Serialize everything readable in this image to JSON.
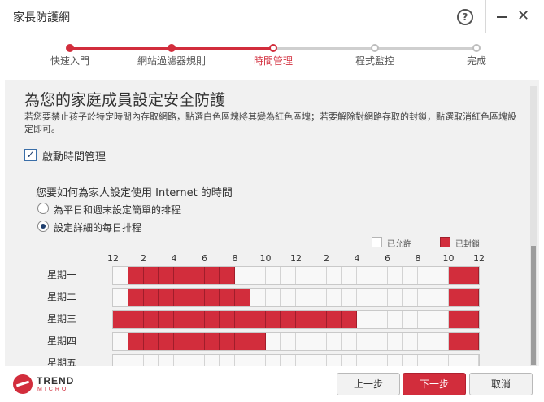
{
  "window": {
    "title": "家長防護網"
  },
  "wizard": {
    "steps": [
      {
        "label": "快速入門",
        "state": "done"
      },
      {
        "label": "網站過濾器規則",
        "state": "done"
      },
      {
        "label": "時間管理",
        "state": "current"
      },
      {
        "label": "程式監控",
        "state": "todo"
      },
      {
        "label": "完成",
        "state": "todo"
      }
    ]
  },
  "main": {
    "title": "為您的家庭成員設定安全防護",
    "description": "若您要禁止孩子於特定時間內存取網路，點選白色區塊將其變為紅色區塊；若要解除對網路存取的封鎖，點選取消紅色區塊設定即可。",
    "enable_checkbox": {
      "label": "啟動時間管理",
      "checked": true
    },
    "question": "您要如何為家人設定使用 Internet 的時間",
    "options": [
      {
        "label": "為平日和週末設定簡單的排程",
        "selected": false
      },
      {
        "label": "設定詳細的每日排程",
        "selected": true
      }
    ]
  },
  "schedule": {
    "legend": {
      "allowed": "已允許",
      "blocked": "已封鎖"
    },
    "hour_labels": [
      "12",
      "2",
      "4",
      "6",
      "8",
      "10",
      "12",
      "2",
      "4",
      "6",
      "8",
      "10",
      "12"
    ],
    "days": [
      {
        "label": "星期一",
        "blocked_hours": [
          1,
          2,
          3,
          4,
          5,
          6,
          7,
          22,
          23
        ]
      },
      {
        "label": "星期二",
        "blocked_hours": [
          1,
          2,
          3,
          4,
          5,
          6,
          7,
          8,
          22,
          23
        ]
      },
      {
        "label": "星期三",
        "blocked_hours": [
          0,
          1,
          2,
          3,
          4,
          5,
          6,
          7,
          8,
          9,
          10,
          11,
          12,
          13,
          14,
          15,
          22,
          23
        ]
      },
      {
        "label": "星期四",
        "blocked_hours": [
          1,
          2,
          3,
          4,
          5,
          6,
          7,
          8,
          9,
          22,
          23
        ]
      },
      {
        "label": "星期五",
        "blocked_hours": []
      }
    ]
  },
  "footer": {
    "logo_text": "TREND",
    "logo_sub": "MICRO",
    "back_label": "上一步",
    "next_label": "下一步",
    "cancel_label": "取消"
  },
  "colors": {
    "accent": "#d22d3c",
    "allowed": "#f8f8f8",
    "blocked": "#d22d3c"
  }
}
